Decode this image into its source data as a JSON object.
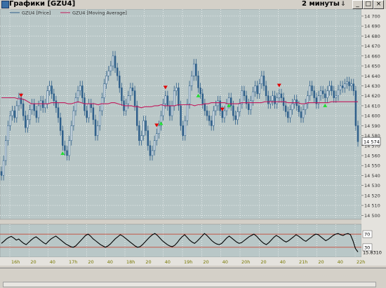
{
  "window": {
    "title": "Графики [GZU4]",
    "interval": "2 минуты",
    "interval_icon": "download-arrow-icon",
    "buttons": [
      "minimize-icon",
      "maximize-icon",
      "close-icon"
    ]
  },
  "colors": {
    "plot_bg": "#b9c7c7",
    "candle": "#2e5f8a",
    "ma": "#c2185b",
    "grid": "#ffffff",
    "rsi_line": "#000000",
    "rsi_bounds": "#c8301e",
    "sell_marker": "#e00000",
    "buy_marker": "#22dd33"
  },
  "chart_data": [
    {
      "type": "candlestick",
      "legend": [
        "GZU4 [Price]",
        "GZU4 [Moving Average]"
      ],
      "legend_placement": "top-left",
      "y_ticks": [
        "14 700",
        "14 690",
        "14 680",
        "14 670",
        "14 660",
        "14 650",
        "14 640",
        "14 630",
        "14 620",
        "14 610",
        "14 600",
        "14 590",
        "14 580",
        "14 570",
        "14 560",
        "14 550",
        "14 540",
        "14 530",
        "14 520",
        "14 510",
        "14 500"
      ],
      "ylim": [
        14496,
        14707
      ],
      "x_ticks": [
        "16h",
        "20",
        "40",
        "17h",
        "20",
        "40",
        "18h",
        "20",
        "40",
        "19h",
        "20",
        "40",
        "20h",
        "20",
        "40",
        "21h",
        "20",
        "40",
        "22h"
      ],
      "last_price_label": "14 574",
      "close": [
        14540,
        14555,
        14575,
        14590,
        14600,
        14605,
        14598,
        14610,
        14618,
        14612,
        14600,
        14588,
        14596,
        14606,
        14612,
        14605,
        14598,
        14610,
        14615,
        14608,
        14612,
        14625,
        14630,
        14622,
        14615,
        14608,
        14598,
        14585,
        14570,
        14565,
        14560,
        14575,
        14590,
        14605,
        14618,
        14625,
        14630,
        14618,
        14605,
        14598,
        14612,
        14608,
        14596,
        14580,
        14590,
        14605,
        14618,
        14632,
        14640,
        14645,
        14650,
        14660,
        14648,
        14640,
        14628,
        14615,
        14605,
        14612,
        14620,
        14628,
        14625,
        14610,
        14590,
        14575,
        14580,
        14595,
        14585,
        14570,
        14560,
        14565,
        14575,
        14582,
        14590,
        14600,
        14612,
        14620,
        14610,
        14600,
        14610,
        14625,
        14628,
        14610,
        14590,
        14580,
        14595,
        14612,
        14630,
        14640,
        14652,
        14640,
        14628,
        14622,
        14612,
        14605,
        14600,
        14595,
        14590,
        14605,
        14610,
        14615,
        14605,
        14598,
        14605,
        14612,
        14618,
        14610,
        14600,
        14596,
        14604,
        14612,
        14625,
        14620,
        14612,
        14606,
        14615,
        14624,
        14630,
        14622,
        14632,
        14640,
        14630,
        14620,
        14612,
        14615,
        14620,
        14612,
        14618,
        14622,
        14618,
        14610,
        14604,
        14598,
        14606,
        14612,
        14616,
        14610,
        14604,
        14598,
        14606,
        14612,
        14620,
        14630,
        14625,
        14618,
        14612,
        14620,
        14625,
        14622,
        14618,
        14625,
        14630,
        14625,
        14618,
        14620,
        14626,
        14630,
        14628,
        14632,
        14634,
        14630,
        14632,
        14625,
        14590,
        14574
      ],
      "moving_average": [
        14618,
        14618,
        14618,
        14618,
        14618,
        14617,
        14617,
        14616,
        14614,
        14612,
        14612,
        14612,
        14612,
        14612,
        14612,
        14613,
        14613,
        14613,
        14613,
        14613,
        14612,
        14612,
        14613,
        14614,
        14613,
        14612,
        14612,
        14612,
        14612,
        14611,
        14612,
        14612,
        14612,
        14613,
        14613,
        14612,
        14611,
        14610,
        14610,
        14610,
        14609,
        14609,
        14608,
        14609,
        14609,
        14609,
        14610,
        14610,
        14611,
        14610,
        14610,
        14610,
        14610,
        14611,
        14611,
        14611,
        14611,
        14611,
        14610,
        14611,
        14611,
        14612,
        14612,
        14613,
        14613,
        14613,
        14613,
        14613,
        14612,
        14612,
        14612,
        14612,
        14613,
        14613,
        14613,
        14613,
        14613,
        14613,
        14613,
        14614,
        14614,
        14614,
        14614,
        14614,
        14614,
        14614,
        14613,
        14613,
        14613,
        14613,
        14612,
        14612,
        14613,
        14613,
        14613,
        14613,
        14613,
        14613,
        14613,
        14614,
        14614,
        14614,
        14614,
        14614,
        14614,
        14614,
        14614,
        14614
      ],
      "sell_signal_index": [
        9,
        71,
        75,
        101,
        127
      ],
      "buy_signal_index": [
        28,
        73,
        90,
        104,
        148
      ]
    },
    {
      "type": "line",
      "y_ticks": [
        "70",
        "30"
      ],
      "ylim": [
        0,
        100
      ],
      "bounds": [
        70,
        30
      ],
      "last_value_label": "15.8310",
      "values": [
        42,
        48,
        55,
        60,
        63,
        58,
        52,
        55,
        48,
        42,
        38,
        45,
        52,
        58,
        62,
        56,
        50,
        44,
        40,
        48,
        55,
        60,
        64,
        58,
        52,
        46,
        40,
        36,
        32,
        30,
        34,
        42,
        50,
        58,
        66,
        70,
        64,
        56,
        50,
        44,
        38,
        34,
        30,
        34,
        40,
        48,
        56,
        62,
        68,
        64,
        58,
        52,
        46,
        40,
        34,
        30,
        32,
        38,
        46,
        54,
        62,
        68,
        72,
        66,
        58,
        50,
        44,
        38,
        34,
        32,
        36,
        44,
        54,
        62,
        68,
        60,
        52,
        46,
        42,
        48,
        56,
        64,
        72,
        66,
        58,
        50,
        44,
        40,
        38,
        42,
        50,
        58,
        64,
        58,
        52,
        46,
        42,
        44,
        50,
        56,
        62,
        66,
        70,
        64,
        56,
        48,
        42,
        38,
        44,
        52,
        60,
        66,
        62,
        56,
        50,
        46,
        50,
        56,
        62,
        68,
        64,
        58,
        52,
        48,
        54,
        60,
        66,
        70,
        68,
        62,
        56,
        50,
        54,
        60,
        66,
        70,
        72,
        68,
        66,
        70,
        72,
        68,
        50,
        26,
        16
      ]
    }
  ]
}
